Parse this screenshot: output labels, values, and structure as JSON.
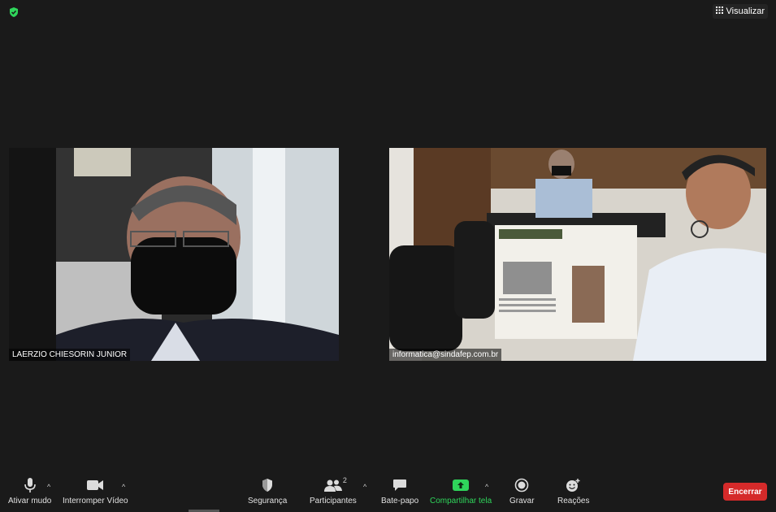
{
  "header": {
    "view_label": "Visualizar",
    "security_color": "#2fd55b"
  },
  "participants": [
    {
      "name": "LAERZIO CHIESORIN JUNIOR"
    },
    {
      "name": "informatica@sindafep.com.br"
    }
  ],
  "toolbar": {
    "mute_label": "Ativar mudo",
    "video_label": "Interromper Vídeo",
    "security_label": "Segurança",
    "participants_label": "Participantes",
    "participants_count": "2",
    "chat_label": "Bate-papo",
    "share_label": "Compartilhar tela",
    "record_label": "Gravar",
    "reactions_label": "Reações",
    "end_label": "Encerrar",
    "share_color": "#2fd55b",
    "end_color": "#d52a2a"
  }
}
